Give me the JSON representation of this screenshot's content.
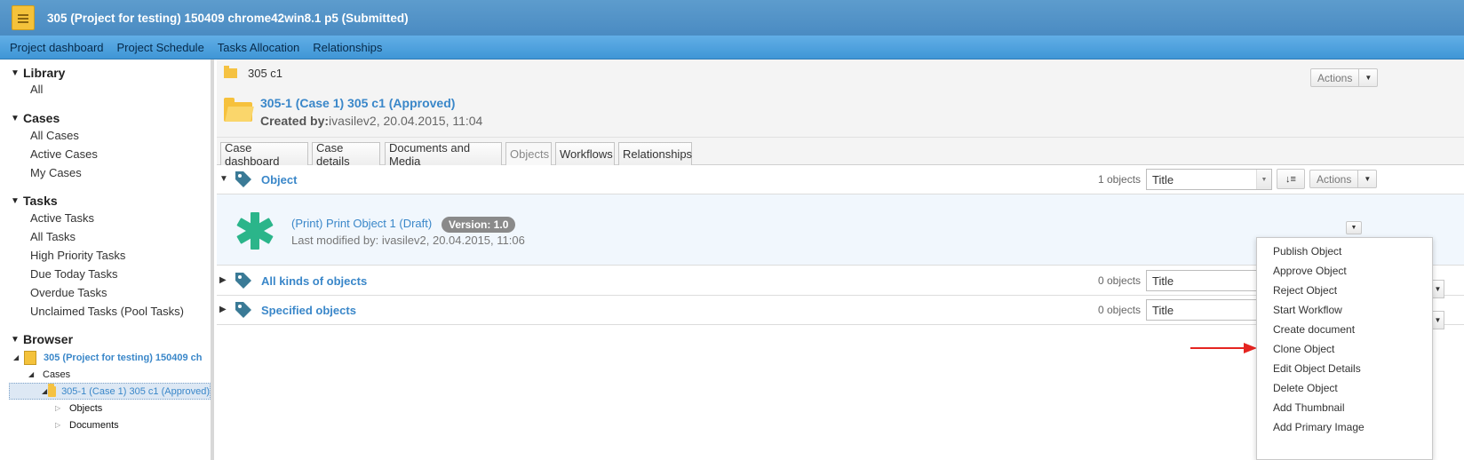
{
  "titlebar": {
    "title": "305 (Project for testing) 150409 chrome42win8.1 p5 (Submitted)"
  },
  "navbar": {
    "items": [
      "Project dashboard",
      "Project Schedule",
      "Tasks Allocation",
      "Relationships"
    ]
  },
  "sidebar": {
    "library": {
      "title": "Library",
      "items": [
        "All"
      ]
    },
    "cases": {
      "title": "Cases",
      "items": [
        "All Cases",
        "Active Cases",
        "My Cases"
      ]
    },
    "tasks": {
      "title": "Tasks",
      "items": [
        "Active Tasks",
        "All Tasks",
        "High Priority Tasks",
        "Due Today Tasks",
        "Overdue Tasks",
        "Unclaimed Tasks (Pool Tasks)"
      ]
    },
    "browser": {
      "title": "Browser",
      "project": "305 (Project for testing) 150409 ch",
      "cases_node": "Cases",
      "case_node": "305-1 (Case 1) 305 c1 (Approved)",
      "objects_node": "Objects",
      "documents_node": "Documents"
    }
  },
  "main": {
    "breadcrumb": "305 c1",
    "case_title": "305-1 (Case 1) 305 c1 (Approved)",
    "created_by_label": "Created by:",
    "created_by_value": "ivasilev2, 20.04.2015, 11:04",
    "actions_label": "Actions",
    "tabs": [
      "Case dashboard",
      "Case details",
      "Documents and Media",
      "Objects",
      "Workflows",
      "Relationships"
    ],
    "active_tab": "Objects"
  },
  "sections": [
    {
      "title": "Object",
      "count": "1 objects",
      "sort": "Title",
      "expanded": true
    },
    {
      "title": "All kinds of objects",
      "count": "0 objects",
      "sort": "Title",
      "expanded": false
    },
    {
      "title": "Specified objects",
      "count": "0 objects",
      "sort": "Title",
      "expanded": false
    }
  ],
  "object_item": {
    "name": "(Print) Print Object 1 (Draft)",
    "version": "Version: 1.0",
    "meta": "Last modified by: ivasilev2, 20.04.2015, 11:06",
    "icon_color": "#2bb58a"
  },
  "object_menu": {
    "items": [
      "Publish Object",
      "Approve Object",
      "Reject Object",
      "Start Workflow",
      "Create document",
      "Clone Object",
      "Edit Object Details",
      "Delete Object",
      "Add Thumbnail",
      "Add Primary Image"
    ],
    "highlighted": "Create document"
  },
  "colors": {
    "accent": "#3a87c9",
    "titlebar": "#4a8bc2",
    "navbar": "#4ea2e0",
    "tag_icon": "#3a7a96",
    "arrow": "#e52521"
  }
}
